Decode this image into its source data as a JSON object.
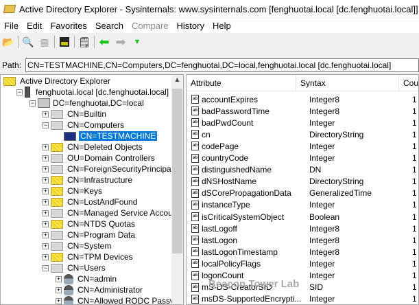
{
  "title": "Active Directory Explorer - Sysinternals: www.sysinternals.com [fenghuotai.local [dc.fenghuotai.local]]",
  "menu": [
    "File",
    "Edit",
    "Favorites",
    "Search",
    "Compare",
    "History",
    "Help"
  ],
  "toolbar": [
    "open-icon",
    "search-icon",
    "compare-icon",
    "save-icon",
    "properties-icon",
    "back-icon",
    "forward-icon",
    "history-dropdown-icon"
  ],
  "path": {
    "label": "Path:",
    "value": "CN=TESTMACHINE,CN=Computers,DC=fenghuotai,DC=local,fenghuotai.local [dc.fenghuotai.local]"
  },
  "tree": [
    {
      "label": "Active Directory Explorer",
      "level": 0,
      "icon": "ade",
      "pm": ""
    },
    {
      "label": "fenghuotai.local [dc.fenghuotai.local]",
      "level": 1,
      "icon": "srv",
      "pm": "−"
    },
    {
      "label": "DC=fenghuotai,DC=local",
      "level": 2,
      "icon": "dom",
      "pm": "−"
    },
    {
      "label": "CN=Builtin",
      "level": 3,
      "icon": "fld",
      "pm": "+"
    },
    {
      "label": "CN=Computers",
      "level": 3,
      "icon": "fld",
      "pm": "−"
    },
    {
      "label": "CN=TESTMACHINE",
      "level": 4,
      "icon": "comp",
      "pm": "",
      "selected": true
    },
    {
      "label": "CN=Deleted Objects",
      "level": 3,
      "icon": "fld y",
      "pm": "+"
    },
    {
      "label": "OU=Domain Controllers",
      "level": 3,
      "icon": "fld",
      "pm": "+"
    },
    {
      "label": "CN=ForeignSecurityPrincipals",
      "level": 3,
      "icon": "fld",
      "pm": "+"
    },
    {
      "label": "CN=Infrastructure",
      "level": 3,
      "icon": "fld y",
      "pm": "+"
    },
    {
      "label": "CN=Keys",
      "level": 3,
      "icon": "fld y",
      "pm": "+"
    },
    {
      "label": "CN=LostAndFound",
      "level": 3,
      "icon": "fld y",
      "pm": "+"
    },
    {
      "label": "CN=Managed Service Accounts",
      "level": 3,
      "icon": "fld",
      "pm": "+"
    },
    {
      "label": "CN=NTDS Quotas",
      "level": 3,
      "icon": "fld y",
      "pm": "+"
    },
    {
      "label": "CN=Program Data",
      "level": 3,
      "icon": "fld",
      "pm": "+"
    },
    {
      "label": "CN=System",
      "level": 3,
      "icon": "fld",
      "pm": "+"
    },
    {
      "label": "CN=TPM Devices",
      "level": 3,
      "icon": "fld y",
      "pm": "+"
    },
    {
      "label": "CN=Users",
      "level": 3,
      "icon": "fld",
      "pm": "−"
    },
    {
      "label": "CN=admin",
      "level": 4,
      "icon": "user",
      "pm": "+"
    },
    {
      "label": "CN=Administrator",
      "level": 4,
      "icon": "user",
      "pm": "+"
    },
    {
      "label": "CN=Allowed RODC Password R",
      "level": 4,
      "icon": "user",
      "pm": "+"
    }
  ],
  "columns": [
    "Attribute",
    "Syntax",
    "Coun"
  ],
  "attributes": [
    [
      "accountExpires",
      "Integer8",
      "1"
    ],
    [
      "badPasswordTime",
      "Integer8",
      "1"
    ],
    [
      "badPwdCount",
      "Integer",
      "1"
    ],
    [
      "cn",
      "DirectoryString",
      "1"
    ],
    [
      "codePage",
      "Integer",
      "1"
    ],
    [
      "countryCode",
      "Integer",
      "1"
    ],
    [
      "distinguishedName",
      "DN",
      "1"
    ],
    [
      "dNSHostName",
      "DirectoryString",
      "1"
    ],
    [
      "dSCorePropagationData",
      "GeneralizedTime",
      "1"
    ],
    [
      "instanceType",
      "Integer",
      "1"
    ],
    [
      "isCriticalSystemObject",
      "Boolean",
      "1"
    ],
    [
      "lastLogoff",
      "Integer8",
      "1"
    ],
    [
      "lastLogon",
      "Integer8",
      "1"
    ],
    [
      "lastLogonTimestamp",
      "Integer8",
      "1"
    ],
    [
      "localPolicyFlags",
      "Integer",
      "1"
    ],
    [
      "logonCount",
      "Integer",
      "1"
    ],
    [
      "mS-DS-CreatorSID",
      "SID",
      "1"
    ],
    [
      "msDS-SupportedEncrypti...",
      "Integer",
      "1"
    ]
  ],
  "watermark": "Beacon Tower Lab"
}
